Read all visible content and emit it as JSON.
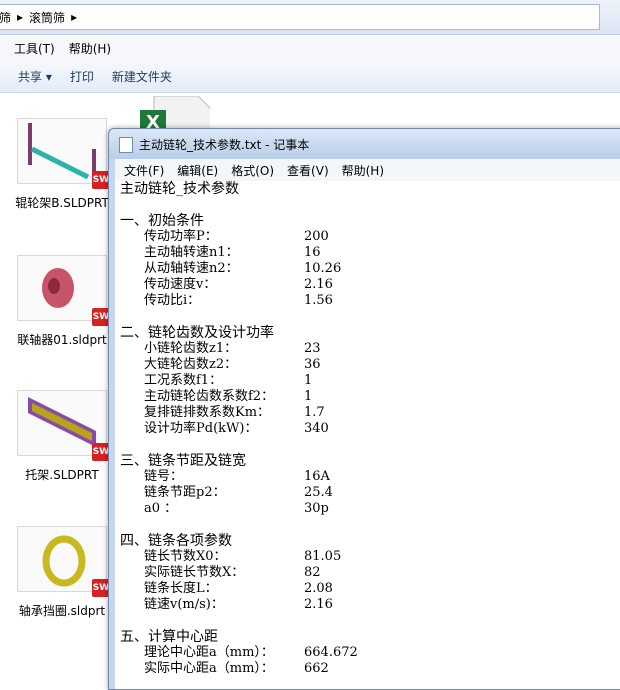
{
  "explorer": {
    "breadcrumb": [
      "筛",
      "滚筒筛"
    ],
    "menu": [
      "工具(T)",
      "帮助(H)"
    ],
    "toolbar": [
      "共享 ▾",
      "打印",
      "新建文件夹"
    ],
    "files": [
      {
        "name": "辊轮架B.SLDPRT",
        "badge": "SW"
      },
      {
        "name": "联轴器01.sldprt",
        "badge": "SW"
      },
      {
        "name": "托架.SLDPRT",
        "badge": "SW"
      },
      {
        "name": "轴承挡圈.sldprt",
        "badge": "SW"
      }
    ]
  },
  "notepad": {
    "title": "主动链轮_技术参数.txt - 记事本",
    "menu": [
      "文件(F)",
      "编辑(E)",
      "格式(O)",
      "查看(V)",
      "帮助(H)"
    ],
    "heading": "主动链轮_技术参数",
    "sections": [
      {
        "title": "一、初始条件",
        "rows": [
          {
            "k": "传动功率P：",
            "v": "200"
          },
          {
            "k": "主动轴转速n1：",
            "v": "16"
          },
          {
            "k": "从动轴转速n2：",
            "v": "10.26"
          },
          {
            "k": "传动速度v：",
            "v": "2.16"
          },
          {
            "k": "传动比i：",
            "v": "1.56"
          }
        ]
      },
      {
        "title": "二、链轮齿数及设计功率",
        "rows": [
          {
            "k": "小链轮齿数z1：",
            "v": "23"
          },
          {
            "k": "大链轮齿数z2：",
            "v": "36"
          },
          {
            "k": "工况系数f1：",
            "v": "1"
          },
          {
            "k": "主动链轮齿数系数f2：",
            "v": "1"
          },
          {
            "k": "复排链排数系数Km：",
            "v": "1.7"
          },
          {
            "k": "设计功率Pd(kW)：",
            "v": "340"
          }
        ]
      },
      {
        "title": "三、链条节距及链宽",
        "rows": [
          {
            "k": "链号：",
            "v": "16A"
          },
          {
            "k": "链条节距p2：",
            "v": "25.4"
          },
          {
            "k": "a0 ：",
            "v": "30p"
          }
        ]
      },
      {
        "title": "四、链条各项参数",
        "rows": [
          {
            "k": "链长节数X0：",
            "v": "81.05"
          },
          {
            "k": "实际链长节数X：",
            "v": "82"
          },
          {
            "k": "链条长度L：",
            "v": "2.08"
          },
          {
            "k": "链速v(m/s)：",
            "v": "2.16"
          }
        ]
      },
      {
        "title": "五、计算中心距",
        "rows": [
          {
            "k": "理论中心距a（mm）：",
            "v": "664.672"
          },
          {
            "k": "实际中心距a（mm）：",
            "v": "662"
          }
        ]
      }
    ]
  }
}
